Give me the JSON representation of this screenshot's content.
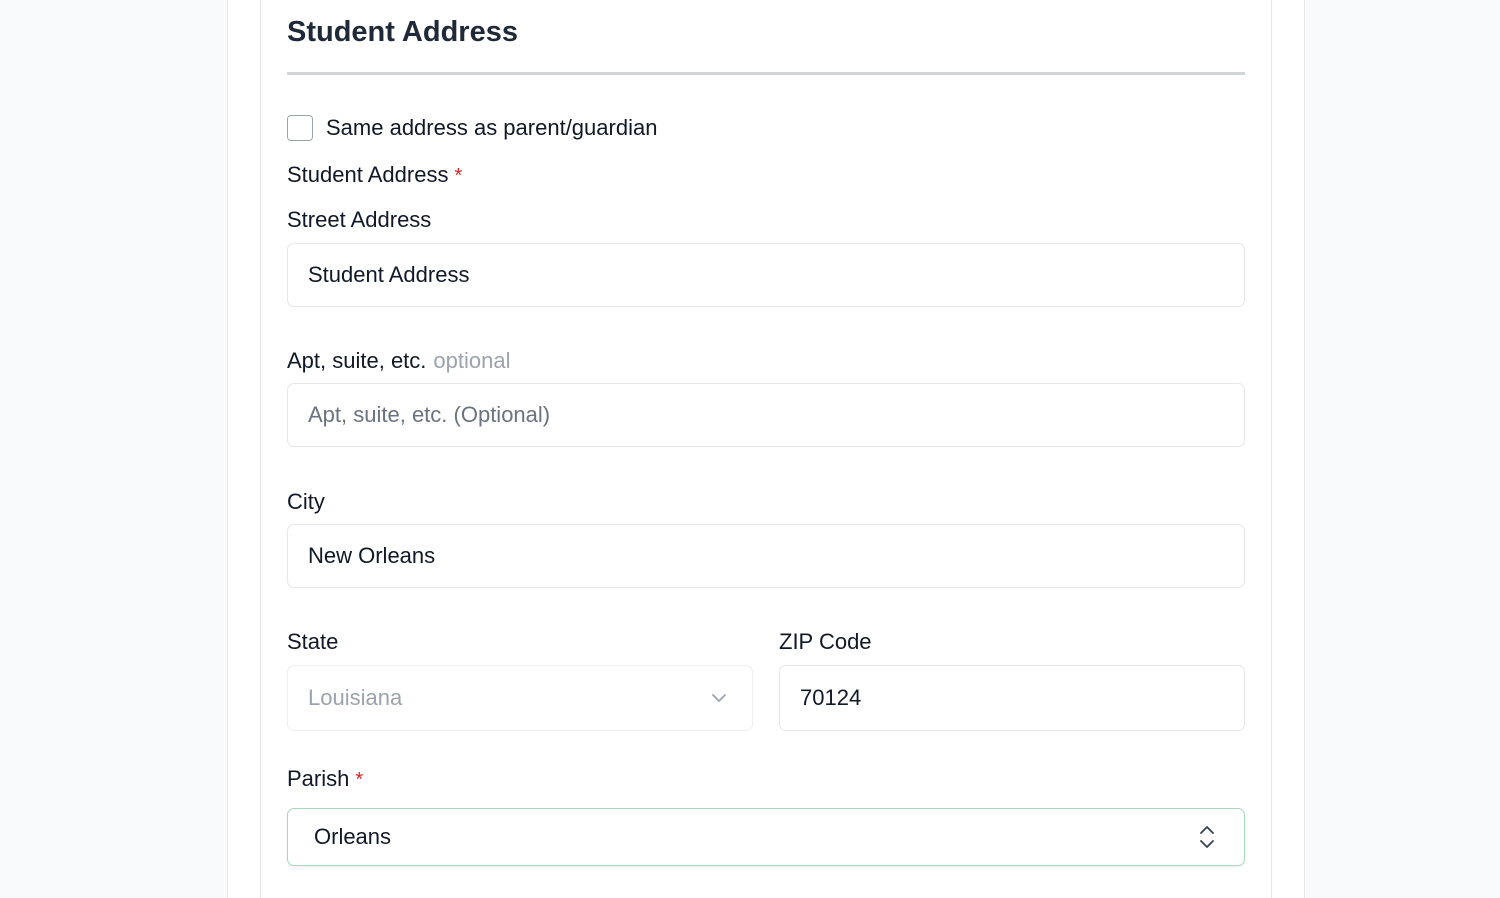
{
  "section": {
    "title": "Student Address",
    "same_as_guardian_label": "Same address as parent/guardian",
    "same_as_guardian_checked": false
  },
  "address": {
    "group_label": "Student Address",
    "required_mark": "*",
    "street": {
      "label": "Street Address",
      "value": "Student Address",
      "placeholder": ""
    },
    "apt": {
      "label": "Apt, suite, etc.",
      "optional_tag": "optional",
      "value": "",
      "placeholder": "Apt, suite, etc. (Optional)"
    },
    "city": {
      "label": "City",
      "value": "New Orleans"
    },
    "state": {
      "label": "State",
      "value": "Louisiana",
      "icon": "chevron-down-icon"
    },
    "zip": {
      "label": "ZIP Code",
      "value": "70124"
    }
  },
  "parish": {
    "label": "Parish",
    "required_mark": "*",
    "value": "Orleans",
    "icon": "chevron-up-down-icon"
  },
  "colors": {
    "required": "#dc2626",
    "active_border": "#a7d9c0",
    "muted_text": "#9ca3af"
  }
}
